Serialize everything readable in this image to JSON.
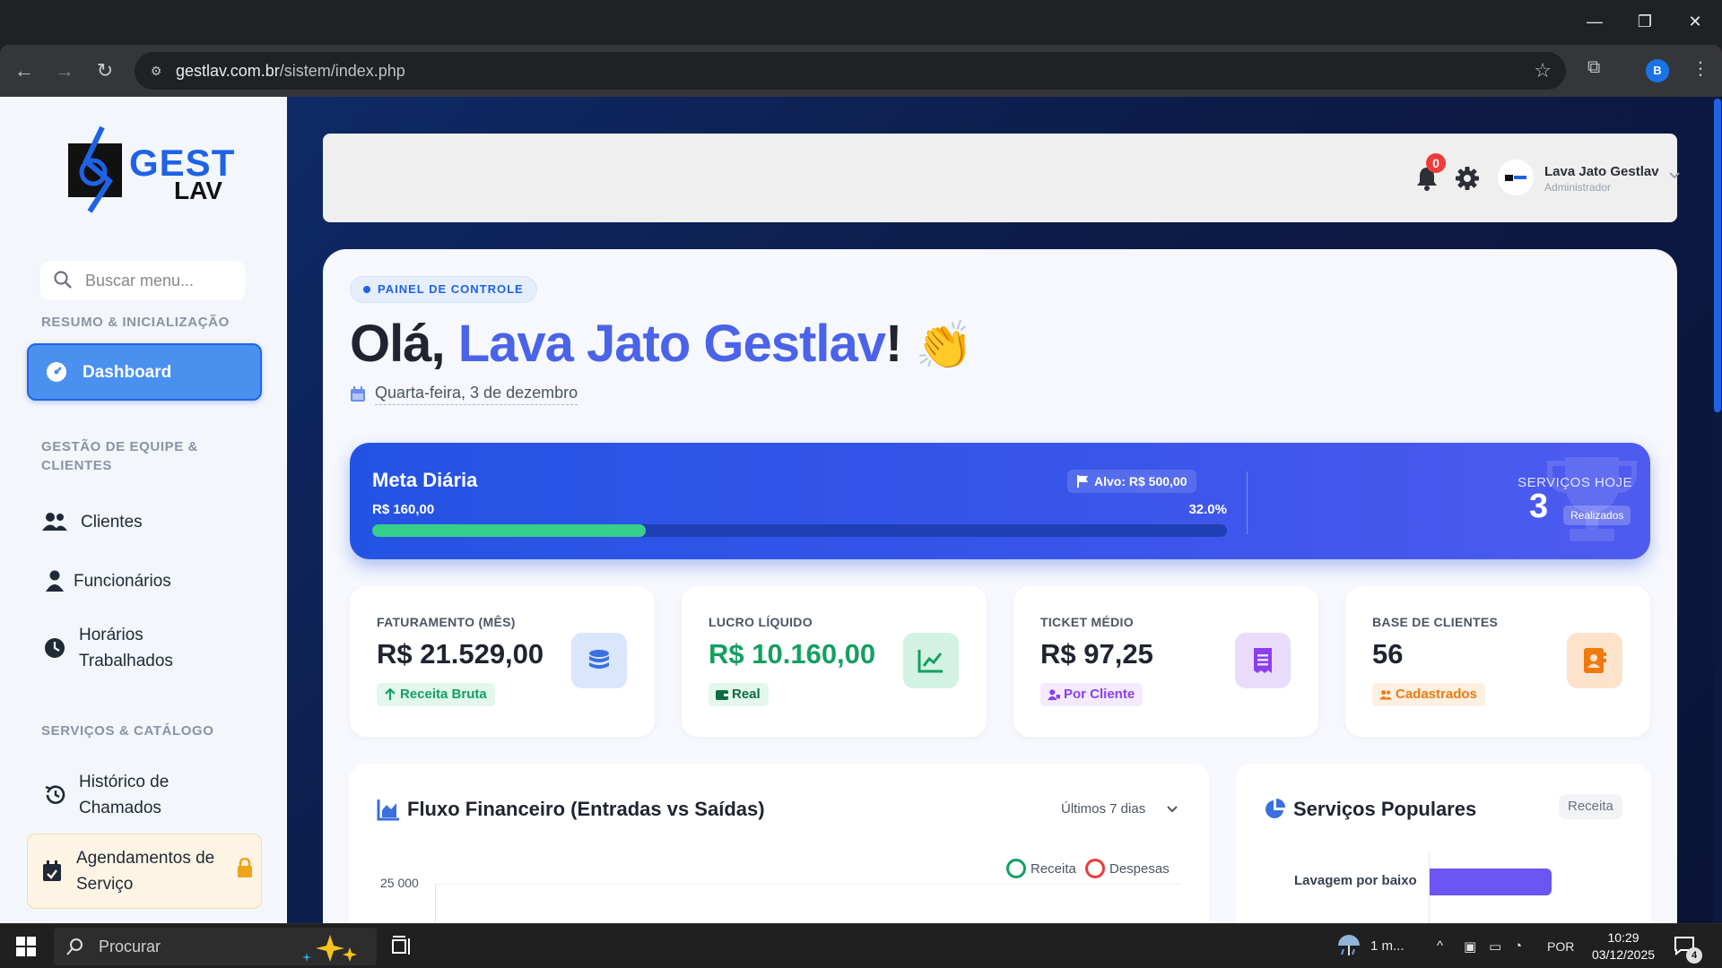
{
  "browser": {
    "url_host": "gestlav.com.br",
    "url_path": "/sistem/index.php",
    "profile_initial": "B"
  },
  "sidebar": {
    "logo_top": "GEST",
    "logo_bottom": "LAV",
    "search_placeholder": "Buscar menu...",
    "sections": {
      "resumo": "RESUMO & INICIALIZAÇÃO",
      "gestao": "GESTÃO DE EQUIPE & CLIENTES",
      "servicos": "SERVIÇOS & CATÁLOGO"
    },
    "items": {
      "dashboard": "Dashboard",
      "clientes": "Clientes",
      "funcionarios": "Funcionários",
      "horarios": "Horários Trabalhados",
      "historico": "Histórico de Chamados",
      "agendamentos": "Agendamentos de Serviço"
    }
  },
  "topbar": {
    "notification_count": "0",
    "user_name": "Lava Jato Gestlav",
    "user_role": "Administrador"
  },
  "hero": {
    "pill": "PAINEL DE CONTROLE",
    "greeting": "Olá, ",
    "name": "Lava Jato Gestlav",
    "exclaim": "!",
    "wave": "👏",
    "date": "Quarta-feira, 3 de dezembro"
  },
  "goal": {
    "title": "Meta Diária",
    "current": "R$ 160,00",
    "target": "Alvo: R$ 500,00",
    "percent_label": "32.0%",
    "progress_fraction": 0.32,
    "services_label": "SERVIÇOS HOJE",
    "services_count": "3",
    "services_badge": "Realizados"
  },
  "stats": [
    {
      "label": "FATURAMENTO (MÊS)",
      "value": "R$ 21.529,00",
      "chip": "Receita Bruta",
      "icon": "coins-icon"
    },
    {
      "label": "LUCRO LÍQUIDO",
      "value": "R$ 10.160,00",
      "chip": "Real",
      "icon": "chart-line-icon"
    },
    {
      "label": "TICKET MÉDIO",
      "value": "R$ 97,25",
      "chip": "Por Cliente",
      "icon": "receipt-icon"
    },
    {
      "label": "BASE DE CLIENTES",
      "value": "56",
      "chip": "Cadastrados",
      "icon": "address-book-icon"
    }
  ],
  "flow_panel": {
    "title": "Fluxo Financeiro (Entradas vs Saídas)",
    "range": "Últimos 7 dias",
    "legend_income": "Receita",
    "legend_expense": "Despesas",
    "y_tick": "25 000"
  },
  "popular_panel": {
    "title": "Serviços Populares",
    "badge": "Receita",
    "bar_label": "Lavagem por baixo"
  },
  "taskbar": {
    "search": "Procurar",
    "weather": "1 m...",
    "lang": "POR",
    "time": "10:29",
    "date": "03/12/2025",
    "notifications": "4"
  },
  "colors": {
    "accent": "#1e63e6",
    "goal_fill": "#37d08a",
    "profit": "#13a062",
    "popular_bar": "#6c55f2"
  }
}
